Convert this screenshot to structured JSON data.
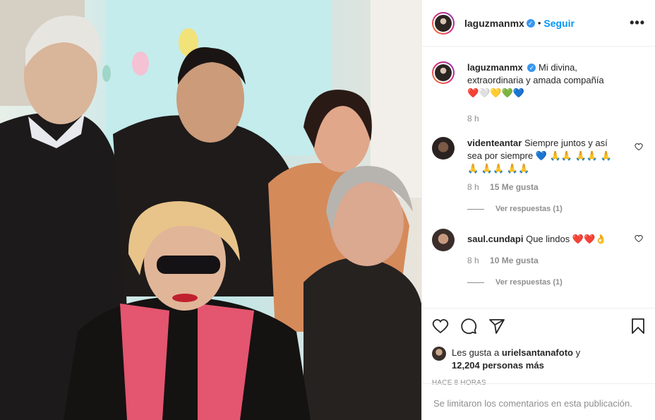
{
  "post": {
    "username": "laguzmanmx",
    "follow_label": "Seguir",
    "more_label": "•••",
    "caption": {
      "text": "Mi divina, extraordinaria y amada compañía ❤️🤍💛💚💙",
      "time": "8 h"
    },
    "comments": [
      {
        "user": "videnteantar",
        "text": "Siempre juntos y así sea por siempre 💙 🙏🙏 🙏🙏 🙏🙏 🙏🙏 🙏🙏",
        "time": "8 h",
        "likes": "15 Me gusta",
        "replies": "Ver respuestas (1)"
      },
      {
        "user": "saul.cundapi",
        "text": "Que lindos ❤️❤️👌",
        "time": "8 h",
        "likes": "10 Me gusta",
        "replies": "Ver respuestas (1)"
      }
    ],
    "likes_line1": "Les gusta a",
    "likes_user": "urielsantanafoto",
    "likes_and": "y",
    "likes_count": "12,204 personas más",
    "posted_ago": "HACE 8 HORAS",
    "comments_limited": "Se limitaron los comentarios en esta publicación."
  },
  "icons": [
    "heart-icon",
    "comment-icon",
    "share-icon",
    "bookmark-icon",
    "verified-icon",
    "more-options-icon"
  ],
  "colors": {
    "accent": "#0095f6",
    "verified": "#3897f0",
    "muted": "#8e8e8e",
    "text": "#262626"
  }
}
